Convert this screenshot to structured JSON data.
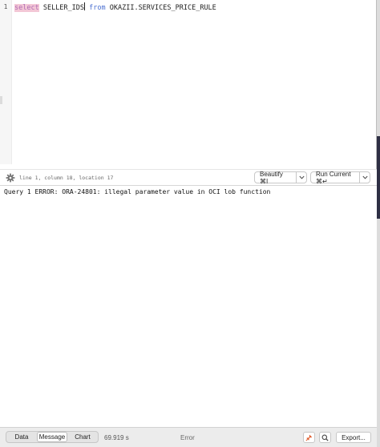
{
  "editor": {
    "line_number": "1",
    "code": {
      "kw_select": "select",
      "columns": " SELLER_IDS",
      "kw_from": "from",
      "table": " OKAZII.SERVICES_PRICE_RULE"
    }
  },
  "editor_bar": {
    "position": "line 1, column 18, location 17",
    "beautify_label": "Beautify ⌘I",
    "run_label": "Run Current ⌘↵"
  },
  "output": {
    "message": "Query 1 ERROR: ORA-24801: illegal parameter value in OCI lob function"
  },
  "bottom_bar": {
    "tabs": [
      "Data",
      "Message",
      "Chart"
    ],
    "selected_tab": "Message",
    "elapsed": "69.919 s",
    "status": "Error",
    "export_label": "Export..."
  },
  "colors": {
    "keyword_select": "#b06ab3",
    "keyword_select_bg": "#f3c7d6",
    "keyword_from": "#4a6fd1",
    "pin_icon": "#e05a2b"
  }
}
